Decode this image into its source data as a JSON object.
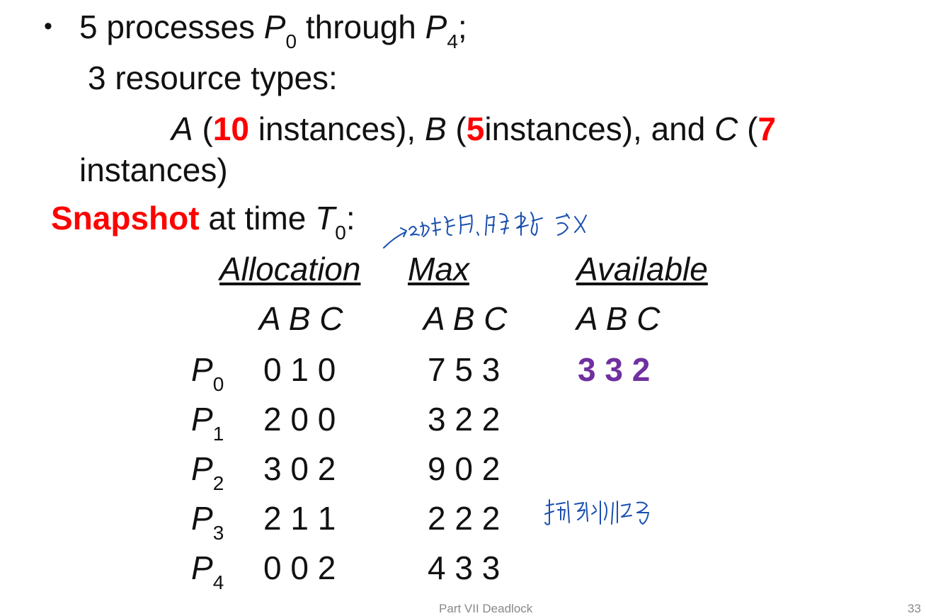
{
  "intro": {
    "bullet": "•",
    "processes_prefix": "5 processes ",
    "p_start": "P",
    "p_start_sub": "0",
    "through": " through ",
    "p_end": "P",
    "p_end_sub": "4",
    "semicolon": ";",
    "resource_types": "3 resource types:",
    "a": "A",
    "a_open": " (",
    "a_count": "10",
    "a_rest": " instances),  ",
    "b": "B",
    "b_open": " (",
    "b_count": "5",
    "b_rest": "instances), and ",
    "c": "C",
    "c_open": " (",
    "c_count": "7",
    "c_rest": "instances)"
  },
  "snapshot": {
    "word": "Snapshot",
    "rest": " at time ",
    "t": "T",
    "t_sub": "0",
    "colon": ":"
  },
  "table": {
    "headers": {
      "allocation": "Allocation",
      "max": "Max",
      "available": "Available"
    },
    "abc": "A B C",
    "available_value": "3 3 2",
    "rows": [
      {
        "p": "P",
        "sub": "0",
        "alloc": "0 1 0",
        "max": "7 5 3"
      },
      {
        "p": "P",
        "sub": "1",
        "alloc": "2 0 0",
        "max": "3 2 2"
      },
      {
        "p": "P",
        "sub": "2",
        "alloc": "3 0 2",
        "max": "9 0 2"
      },
      {
        "p": "P",
        "sub": "3",
        "alloc": "2 1 1",
        "max": "2 2 2"
      },
      {
        "p": "P",
        "sub": "4",
        "alloc": "0 0 2",
        "max": "4 3 3"
      }
    ]
  },
  "footer": {
    "text": "Part VII Deadlock",
    "page": "33"
  },
  "colors": {
    "red": "#ff0000",
    "purple": "#7030a0",
    "ink": "#1a4fb0"
  }
}
